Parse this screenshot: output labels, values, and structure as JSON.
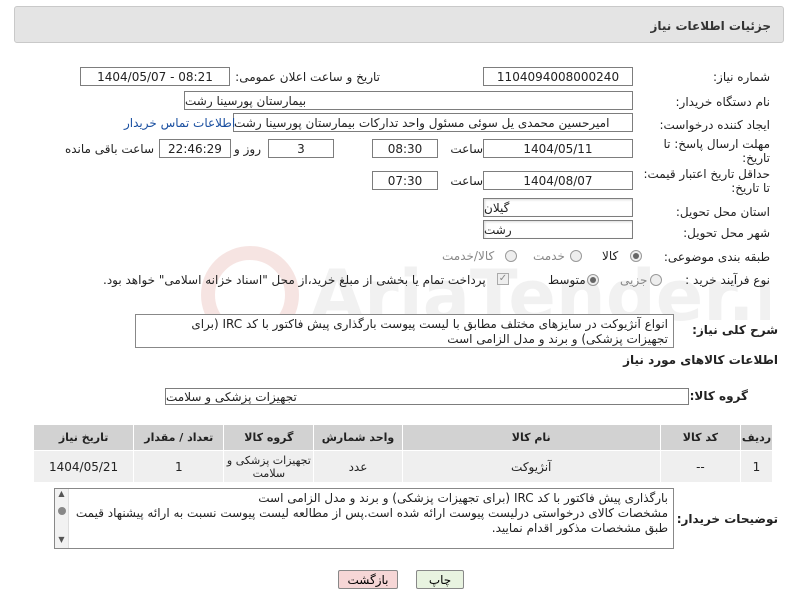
{
  "header": {
    "title": "جزئیات اطلاعات نیاز"
  },
  "fields": {
    "need_number_label": "شماره نیاز:",
    "need_number": "1104094008000240",
    "announce_label": "تاریخ و ساعت اعلان عمومی:",
    "announce_value": "1404/05/07 - 08:21",
    "buyer_org_label": "نام دستگاه خریدار:",
    "buyer_org": "بیمارستان پورسینا رشت",
    "creator_label": "ایجاد کننده درخواست:",
    "creator": "امیرحسین محمدی یل سوئی مسئول واحد تدارکات بیمارستان پورسینا رشت",
    "contact_link": "اطلاعات تماس خریدار",
    "deadline_label": "مهلت ارسال پاسخ: تا تاریخ:",
    "deadline_date": "1404/05/11",
    "time_label": "ساعت",
    "deadline_time": "08:30",
    "days_value": "3",
    "days_label": "روز و",
    "remaining_time": "22:46:29",
    "remaining_label": "ساعت باقی مانده",
    "price_valid_label": "حداقل تاریخ اعتبار قیمت: تا تاریخ:",
    "price_valid_date": "1404/08/07",
    "price_valid_time": "07:30",
    "province_label": "استان محل تحویل:",
    "province": "گیلان",
    "city_label": "شهر محل تحویل:",
    "city": "رشت",
    "category_label": "طبقه بندی موضوعی:",
    "category_options": [
      "کالا",
      "خدمت",
      "کالا/خدمت"
    ],
    "process_label": "نوع فرآیند خرید :",
    "process_options": [
      "جزیی",
      "متوسط"
    ],
    "payment_note": "پرداخت تمام یا بخشی از مبلغ خرید،از محل \"اسناد خزانه اسلامی\" خواهد بود."
  },
  "description": {
    "label": "شرح کلی نیاز:",
    "text": "انواع آنژیوکت در سایزهای مختلف مطابق با لیست پیوست بارگذاری پیش فاکتور با کد IRC (برای تجهیزات پزشکی) و برند و مدل الزامی است"
  },
  "goods_info": {
    "title": "اطلاعات کالاهای مورد نیاز",
    "group_label": "گروه کالا:",
    "group_value": "تجهیزات پزشکی و سلامت"
  },
  "table": {
    "headers": [
      "ردیف",
      "کد کالا",
      "نام کالا",
      "واحد شمارش",
      "گروه کالا",
      "تعداد / مقدار",
      "تاریخ نیاز"
    ],
    "rows": [
      [
        "1",
        "--",
        "آنژیوکت",
        "عدد",
        "تجهیزات پزشکی و سلامت",
        "1",
        "1404/05/21"
      ]
    ]
  },
  "buyer_notes": {
    "label": "توضیحات خریدار:",
    "line1": "بارگذاری پیش فاکتور با کد IRC (برای تجهیزات پزشکی) و برند و مدل الزامی است",
    "line2": "مشخصات کالای درخواستی درلیست پیوست ارائه شده است.پس از مطالعه لیست پیوست نسبت به ارائه پیشنهاد قیمت",
    "line3": "طبق مشخصات مذکور اقدام نمایید."
  },
  "buttons": {
    "print": "چاپ",
    "back": "بازگشت"
  },
  "watermark": {
    "text": "AriaTender.net"
  },
  "colors": {
    "link": "#1a4fa0",
    "back_button": "#f6d6d6",
    "print_button": "#e8f3e0"
  }
}
